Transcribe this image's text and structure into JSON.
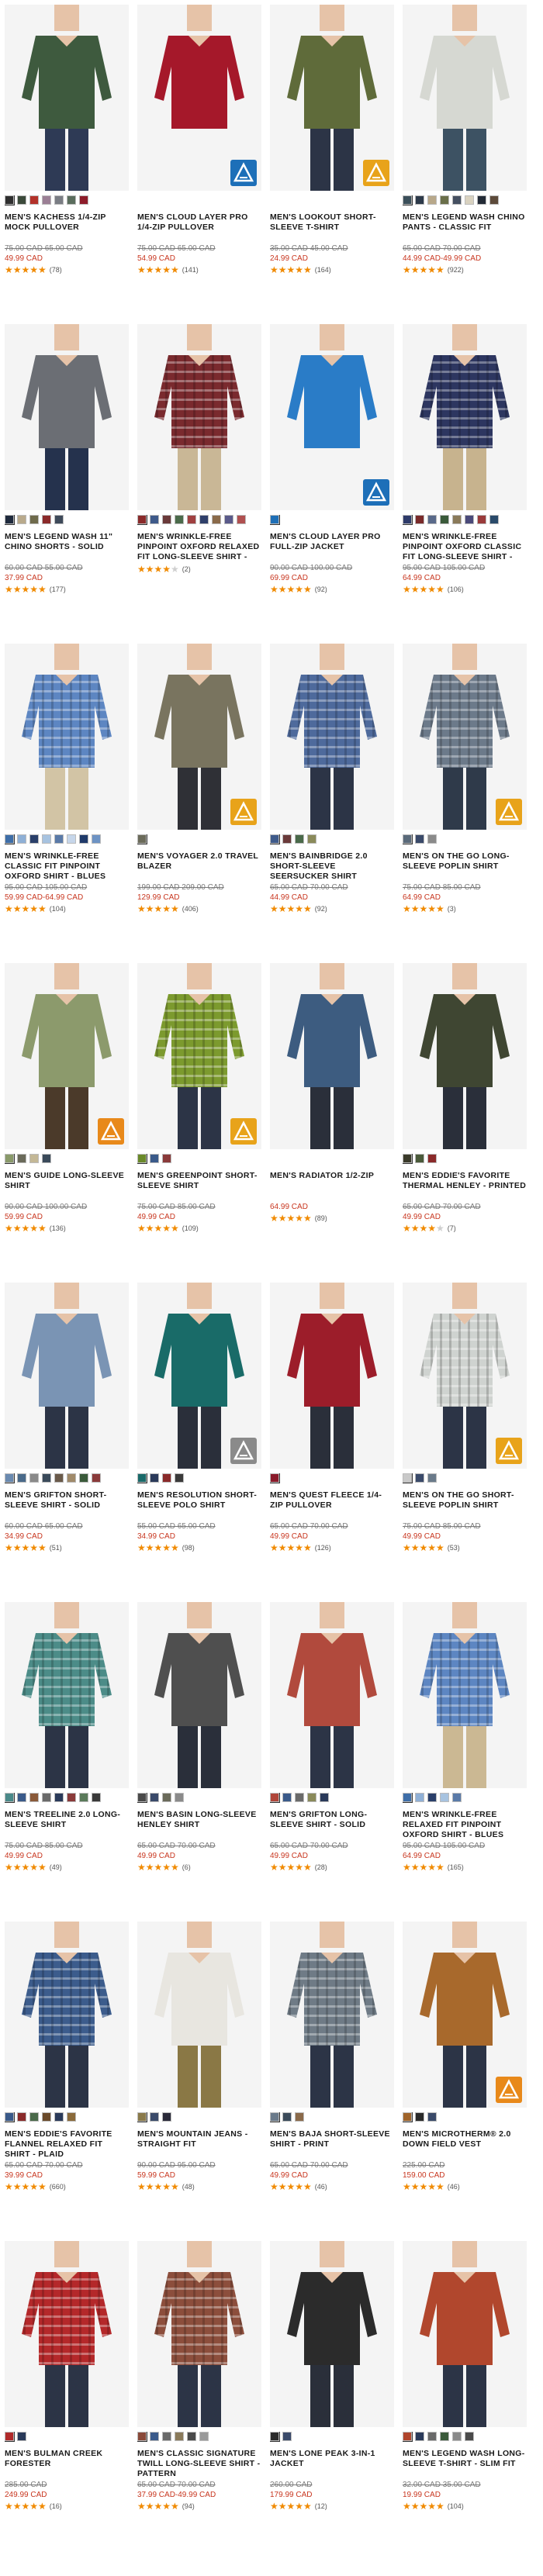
{
  "colors": {
    "sale": "#c8361f",
    "original": "#7a7a7a",
    "star": "#f08a00",
    "star_empty": "#cfcfcf"
  },
  "products": [
    {
      "title": "MEN'S KACHESS 1/4-ZIP MOCK PULLOVER",
      "orig": "75.00 CAD 65.00 CAD",
      "sale": "49.99 CAD",
      "rating": 4.5,
      "reviews": "(78)",
      "swatches": [
        "#2f2f2f",
        "#3b4a3a",
        "#b3322a",
        "#9b7f95",
        "#7a7d84",
        "#5a6d5d",
        "#8d1c2a"
      ],
      "garment": "#3e5a3e",
      "legs": "#2e3a55",
      "badge": ""
    },
    {
      "title": "MEN'S CLOUD LAYER PRO 1/4-ZIP PULLOVER",
      "orig": "75.00 CAD 65.00 CAD",
      "sale": "54.99 CAD",
      "rating": 4.5,
      "reviews": "(141)",
      "swatches": [],
      "garment": "#a5182a",
      "legs": "",
      "badge": "blue"
    },
    {
      "title": "MEN'S LOOKOUT SHORT-SLEEVE T-SHIRT",
      "orig": "35.00 CAD 45.00 CAD",
      "sale": "24.99 CAD",
      "rating": 4.5,
      "reviews": "(164)",
      "swatches": [],
      "garment": "#5f6b3a",
      "legs": "#2c3446",
      "badge": "yellow"
    },
    {
      "title": "MEN'S LEGEND WASH CHINO PANTS - CLASSIC FIT",
      "orig": "65.00 CAD 70.00 CAD",
      "sale": "44.99 CAD-49.99 CAD",
      "rating": 4.5,
      "reviews": "(922)",
      "swatches": [
        "#3b4f5a",
        "#2d3a4a",
        "#b8a88a",
        "#6a6f4a",
        "#455061",
        "#d9d2c0",
        "#222a36",
        "#5c4a3a"
      ],
      "garment": "#d6d8d2",
      "legs": "#3d5263",
      "badge": ""
    },
    {
      "title": "MEN'S LEGEND WASH 11\" CHINO SHORTS - SOLID",
      "orig": "60.00 CAD 55.00 CAD",
      "sale": "37.99 CAD",
      "rating": 4.5,
      "reviews": "(177)",
      "swatches": [
        "#1f2a3d",
        "#b9aa8c",
        "#6f6b4c",
        "#8b2a2a",
        "#3e4a5a"
      ],
      "garment": "#6b6e74",
      "legs": "#25324d",
      "badge": ""
    },
    {
      "title": "MEN'S WRINKLE-FREE PINPOINT OXFORD RELAXED FIT LONG-SLEEVE SHIRT - SEASONAL PATTERN",
      "orig": "",
      "sale": "",
      "rating": 4,
      "reviews": "(2)",
      "swatches": [
        "#8a2a2a",
        "#3e5a8a",
        "#6a3a3a",
        "#4b6b4b",
        "#a04040",
        "#2f3f6a",
        "#8a6a4a",
        "#5a5a8a",
        "#b05050"
      ],
      "garment": "#7a2a2e",
      "legs": "#c9b796",
      "badge": "",
      "plaid": true
    },
    {
      "title": "MEN'S CLOUD LAYER PRO FULL-ZIP JACKET",
      "orig": "90.00 CAD 100.00 CAD",
      "sale": "69.99 CAD",
      "rating": 4.5,
      "reviews": "(92)",
      "swatches": [
        "#1f6fb6"
      ],
      "garment": "#2a7cc7",
      "legs": "",
      "badge": "blue"
    },
    {
      "title": "MEN'S WRINKLE-FREE PINPOINT OXFORD CLASSIC FIT LONG-SLEEVE SHIRT - SEASONAL PATTERN",
      "orig": "95.00 CAD 105.00 CAD",
      "sale": "64.99 CAD",
      "rating": 4.5,
      "reviews": "(106)",
      "swatches": [
        "#2e3b6a",
        "#7a2a2a",
        "#5a6a8a",
        "#3a5a3a",
        "#8a7a5a",
        "#4a4a7a",
        "#9a3a3a",
        "#2a4a6a"
      ],
      "garment": "#2d3660",
      "legs": "#c7b38e",
      "badge": "",
      "plaid": true
    },
    {
      "title": "MEN'S WRINKLE-FREE CLASSIC FIT PINPOINT OXFORD SHIRT - BLUES",
      "orig": "95.00 CAD 105.00 CAD",
      "sale": "59.99 CAD-64.99 CAD",
      "rating": 4.5,
      "reviews": "(104)",
      "swatches": [
        "#3e6ea8",
        "#8fb0d6",
        "#2a3f6a",
        "#a7c3e0",
        "#5a7aa8",
        "#c6d6ea",
        "#1f3a6a",
        "#6d93c4"
      ],
      "garment": "#5d86c2",
      "legs": "#d2c4a5",
      "badge": "",
      "plaid": true
    },
    {
      "title": "MEN'S VOYAGER 2.0 TRAVEL BLAZER",
      "orig": "199.00 CAD 209.00 CAD",
      "sale": "129.99 CAD",
      "rating": 4.5,
      "reviews": "(406)",
      "swatches": [
        "#6b6b5a"
      ],
      "garment": "#79745f",
      "legs": "#2f3036",
      "badge": "yellow"
    },
    {
      "title": "MEN'S BAINBRIDGE 2.0 SHORT-SLEEVE SEERSUCKER SHIRT",
      "orig": "65.00 CAD 70.00 CAD",
      "sale": "44.99 CAD",
      "rating": 4.5,
      "reviews": "(92)",
      "swatches": [
        "#3e5a8a",
        "#6a3a3a",
        "#4a6a4a",
        "#8a8a5a"
      ],
      "garment": "#4e6a9c",
      "legs": "#2c3446",
      "badge": "",
      "plaid": true
    },
    {
      "title": "MEN'S ON THE GO LONG-SLEEVE POPLIN SHIRT",
      "orig": "75.00 CAD 85.00 CAD",
      "sale": "64.99 CAD",
      "rating": 5,
      "reviews": "(3)",
      "swatches": [
        "#5a6a7a",
        "#3a4a6a",
        "#8a8a8a"
      ],
      "garment": "#6c7a8a",
      "legs": "#2f3a4a",
      "badge": "yellow",
      "plaid": true
    },
    {
      "title": "MEN'S GUIDE LONG-SLEEVE SHIRT",
      "orig": "90.00 CAD 100.00 CAD",
      "sale": "59.99 CAD",
      "rating": 4.5,
      "reviews": "(136)",
      "swatches": [
        "#8a9a6a",
        "#6a6a5a",
        "#c4b896",
        "#3a4a5a"
      ],
      "garment": "#8c9a6c",
      "legs": "#4b3a2a",
      "badge": "orange"
    },
    {
      "title": "MEN'S GREENPOINT SHORT-SLEEVE SHIRT",
      "orig": "75.00 CAD 85.00 CAD",
      "sale": "49.99 CAD",
      "rating": 4.5,
      "reviews": "(109)",
      "swatches": [
        "#6a8a2a",
        "#3a5a8a",
        "#8a3a3a"
      ],
      "garment": "#7c9a2e",
      "legs": "#2c3446",
      "badge": "yellow",
      "plaid": true
    },
    {
      "title": "MEN'S RADIATOR 1/2-ZIP",
      "orig": "",
      "sale": "64.99 CAD",
      "rating": 4.5,
      "reviews": "(89)",
      "swatches": [],
      "garment": "#3d5c80",
      "legs": "#2a2f3a",
      "badge": ""
    },
    {
      "title": "MEN'S EDDIE'S FAVORITE THERMAL HENLEY - PRINTED",
      "orig": "65.00 CAD 70.00 CAD",
      "sale": "49.99 CAD",
      "rating": 4,
      "reviews": "(7)",
      "swatches": [
        "#3a3a2a",
        "#4a5a3a",
        "#8a2a2a"
      ],
      "garment": "#3f4632",
      "legs": "#2a2f3a",
      "badge": ""
    },
    {
      "title": "MEN'S GRIFTON SHORT-SLEEVE SHIRT - SOLID",
      "orig": "60.00 CAD 65.00 CAD",
      "sale": "34.99 CAD",
      "rating": 4.5,
      "reviews": "(51)",
      "swatches": [
        "#6a8ab0",
        "#4a6a8a",
        "#8a8a8a",
        "#3a4a5a",
        "#6a5a4a",
        "#a08a6a",
        "#3a5a3a",
        "#8a3a3a"
      ],
      "garment": "#7a94b4",
      "legs": "#2c3446",
      "badge": ""
    },
    {
      "title": "MEN'S RESOLUTION SHORT-SLEEVE POLO SHIRT",
      "orig": "55.00 CAD 65.00 CAD",
      "sale": "34.99 CAD",
      "rating": 4.5,
      "reviews": "(98)",
      "swatches": [
        "#1a6a6a",
        "#2a3a5a",
        "#8a2a2a",
        "#3a3a3a"
      ],
      "garment": "#196b68",
      "legs": "#2a2f3a",
      "badge": "gray"
    },
    {
      "title": "MEN'S QUEST FLEECE 1/4-ZIP PULLOVER",
      "orig": "65.00 CAD 70.00 CAD",
      "sale": "49.99 CAD",
      "rating": 4.5,
      "reviews": "(126)",
      "swatches": [
        "#8a1a2a"
      ],
      "garment": "#9c1d2a",
      "legs": "#2a2f3a",
      "badge": ""
    },
    {
      "title": "MEN'S ON THE GO SHORT-SLEEVE POPLIN SHIRT",
      "orig": "75.00 CAD 85.00 CAD",
      "sale": "49.99 CAD",
      "rating": 5,
      "reviews": "(53)",
      "swatches": [
        "#c9c9c9",
        "#3a4a6a",
        "#6a7a8a"
      ],
      "garment": "#cfd3d0",
      "legs": "#2c3446",
      "badge": "yellow",
      "plaid": true
    },
    {
      "title": "MEN'S TREELINE 2.0 LONG-SLEEVE SHIRT",
      "orig": "75.00 CAD 85.00 CAD",
      "sale": "49.99 CAD",
      "rating": 4.5,
      "reviews": "(49)",
      "swatches": [
        "#4a8a8a",
        "#3a5a8a",
        "#8a5a3a",
        "#6a6a6a",
        "#2a3a5a",
        "#8a3a3a",
        "#5a7a5a",
        "#3a3a3a"
      ],
      "garment": "#4c8c88",
      "legs": "#2c3446",
      "badge": "",
      "plaid": true
    },
    {
      "title": "MEN'S BASIN LONG-SLEEVE HENLEY SHIRT",
      "orig": "65.00 CAD 70.00 CAD",
      "sale": "49.99 CAD",
      "rating": 4.5,
      "reviews": "(6)",
      "swatches": [
        "#4a4a4a",
        "#3a4a6a",
        "#6a6a5a",
        "#8a8a8a"
      ],
      "garment": "#4f4f4f",
      "legs": "#2a2f3a",
      "badge": ""
    },
    {
      "title": "MEN'S GRIFTON LONG-SLEEVE SHIRT - SOLID",
      "orig": "65.00 CAD 70.00 CAD",
      "sale": "49.99 CAD",
      "rating": 4.5,
      "reviews": "(28)",
      "swatches": [
        "#b0463a",
        "#3a5a8a",
        "#6a6a6a",
        "#8a8a5a",
        "#2a3a5a"
      ],
      "garment": "#b14a3d",
      "legs": "#2c3446",
      "badge": ""
    },
    {
      "title": "MEN'S WRINKLE-FREE RELAXED FIT PINPOINT OXFORD SHIRT - BLUES",
      "orig": "95.00 CAD 105.00 CAD",
      "sale": "64.99 CAD",
      "rating": 4.5,
      "reviews": "(165)",
      "swatches": [
        "#3e6ea8",
        "#8fb0d6",
        "#2a3f6a",
        "#a7c3e0",
        "#5a7aa8"
      ],
      "garment": "#5d86c2",
      "legs": "#cbb893",
      "badge": "",
      "plaid": true
    },
    {
      "title": "MEN'S EDDIE'S FAVORITE FLANNEL RELAXED FIT SHIRT - PLAID",
      "orig": "65.00 CAD 70.00 CAD",
      "sale": "39.99 CAD",
      "rating": 4.5,
      "reviews": "(660)",
      "swatches": [
        "#3a5a8a",
        "#8a2a2a",
        "#4a6a4a",
        "#6a4a2a",
        "#2a3a5a",
        "#8a6a3a"
      ],
      "garment": "#3c5c8c",
      "legs": "#2c3446",
      "badge": "",
      "plaid": true
    },
    {
      "title": "MEN'S MOUNTAIN JEANS - STRAIGHT FIT",
      "orig": "90.00 CAD 95.00 CAD",
      "sale": "59.99 CAD",
      "rating": 4.5,
      "reviews": "(48)",
      "swatches": [
        "#8a7a4a",
        "#3a4a6a",
        "#2a2a3a"
      ],
      "garment": "#e8e6e0",
      "legs": "#8a7845",
      "badge": ""
    },
    {
      "title": "MEN'S BAJA SHORT-SLEEVE SHIRT - PRINT",
      "orig": "65.00 CAD 70.00 CAD",
      "sale": "49.99 CAD",
      "rating": 4.5,
      "reviews": "(46)",
      "swatches": [
        "#6a7a8a",
        "#3a4a5a",
        "#8a6a4a"
      ],
      "garment": "#6f7b86",
      "legs": "#2c3446",
      "badge": "",
      "plaid": true
    },
    {
      "title": "MEN'S MICROTHERM® 2.0 DOWN FIELD VEST",
      "orig": "225.00 CAD",
      "sale": "159.00 CAD",
      "rating": 5,
      "reviews": "(46)",
      "swatches": [
        "#a0642a",
        "#2a2a2a",
        "#3a4a6a"
      ],
      "garment": "#a8692c",
      "legs": "#2c3446",
      "badge": "orange"
    },
    {
      "title": "MEN'S BULMAN CREEK FORESTER",
      "orig": "285.00 CAD",
      "sale": "249.99 CAD",
      "rating": 4.5,
      "reviews": "(16)",
      "swatches": [
        "#b02a2a",
        "#2a3a5a"
      ],
      "garment": "#b4282a",
      "legs": "#2c3446",
      "badge": "",
      "plaid": true
    },
    {
      "title": "MEN'S CLASSIC SIGNATURE TWILL LONG-SLEEVE SHIRT - PATTERN",
      "orig": "65.00 CAD 70.00 CAD",
      "sale": "37.99 CAD-49.99 CAD",
      "rating": 4.5,
      "reviews": "(94)",
      "swatches": [
        "#8a4a3a",
        "#3a5a8a",
        "#6a6a6a",
        "#8a7a5a",
        "#4a4a4a",
        "#9a9a9a"
      ],
      "garment": "#8c4e3c",
      "legs": "#2c3446",
      "badge": "",
      "plaid": true
    },
    {
      "title": "MEN'S LONE PEAK 3-IN-1 JACKET",
      "orig": "260.00 CAD",
      "sale": "179.99 CAD",
      "rating": 4.5,
      "reviews": "(12)",
      "swatches": [
        "#2a2a2a",
        "#3a4a6a"
      ],
      "garment": "#2b2b2b",
      "legs": "#2a2f3a",
      "badge": ""
    },
    {
      "title": "MEN'S LEGEND WASH LONG-SLEEVE T-SHIRT - SLIM FIT",
      "orig": "32.00 CAD 35.00 CAD",
      "sale": "19.99 CAD",
      "rating": 4.5,
      "reviews": "(104)",
      "swatches": [
        "#b0452c",
        "#2a3a5a",
        "#6a6a6a",
        "#3a5a3a",
        "#8a8a8a",
        "#4a4a4a"
      ],
      "garment": "#b1472d",
      "legs": "#2c3446",
      "badge": ""
    }
  ]
}
